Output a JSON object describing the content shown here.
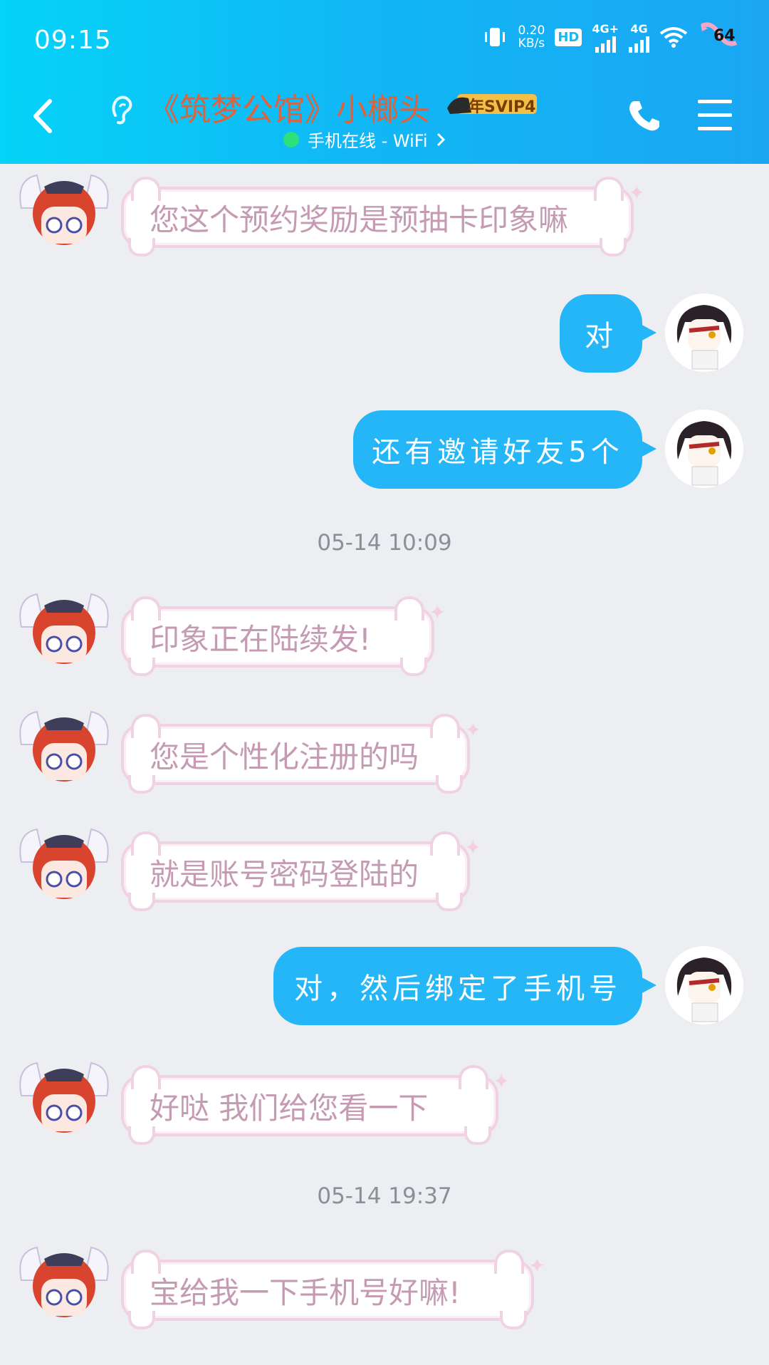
{
  "status_bar": {
    "time": "09:15",
    "net_speed": "0.20",
    "net_unit": "KB/s",
    "hd_badge": "HD",
    "sim1": "4G+",
    "sim2": "4G",
    "battery": "64"
  },
  "header": {
    "title": "《筑梦公馆》小榔头",
    "vip_badge": "年SVIP4",
    "online_status": "手机在线 - WiFi",
    "colors": {
      "header_bg": "#11b8f5",
      "title": "#e0623b",
      "online_dot": "#2ee07a"
    }
  },
  "messages": [
    {
      "side": "left",
      "text": "您这个预约奖励是预抽卡印象嘛"
    },
    {
      "side": "right",
      "text": "对"
    },
    {
      "side": "right",
      "text": "还有邀请好友5个"
    },
    {
      "timestamp": "05-14 10:09"
    },
    {
      "side": "left",
      "text": "印象正在陆续发!"
    },
    {
      "side": "left",
      "text": "您是个性化注册的吗"
    },
    {
      "side": "left",
      "text": "就是账号密码登陆的"
    },
    {
      "side": "right",
      "text": "对，然后绑定了手机号"
    },
    {
      "side": "left",
      "text": "好哒 我们给您看一下"
    },
    {
      "timestamp": "05-14 19:37"
    },
    {
      "side": "left",
      "text": "宝给我一下手机号好嘛!"
    }
  ],
  "icons": {
    "back": "back-arrow-icon",
    "ear": "ear-icon",
    "phone": "phone-icon",
    "menu": "menu-icon"
  },
  "colors": {
    "right_bubble": "#24b6f7",
    "left_bubble_text": "#c49bb2",
    "left_bubble_border": "#f0d3e2",
    "chat_bg": "#eceef2"
  }
}
